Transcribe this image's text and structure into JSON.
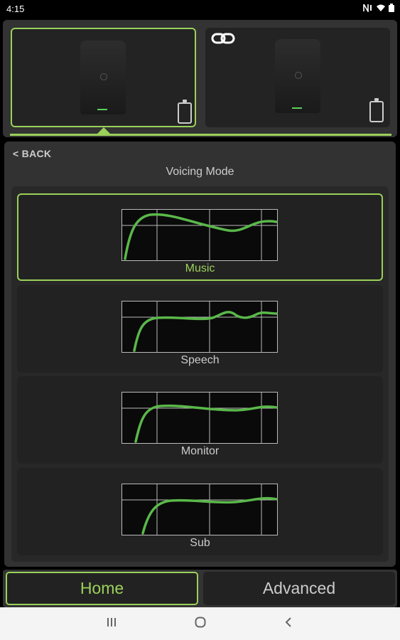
{
  "status_bar": {
    "time": "4:15"
  },
  "speakers": [
    {
      "selected": true,
      "linked": false
    },
    {
      "selected": false,
      "linked": true
    }
  ],
  "panel": {
    "back_label": "< BACK",
    "title": "Voicing Mode"
  },
  "modes": [
    {
      "label": "Music",
      "selected": true
    },
    {
      "label": "Speech",
      "selected": false
    },
    {
      "label": "Monitor",
      "selected": false
    },
    {
      "label": "Sub",
      "selected": false
    }
  ],
  "tabs": [
    {
      "label": "Home",
      "selected": true
    },
    {
      "label": "Advanced",
      "selected": false
    }
  ],
  "nav": {
    "recents_icon": "recents-icon",
    "home_icon": "home-circle-icon",
    "back_icon": "back-chevron-icon"
  },
  "colors": {
    "accent": "#9bd05a",
    "curve": "#5ab84a",
    "background": "#323232"
  }
}
